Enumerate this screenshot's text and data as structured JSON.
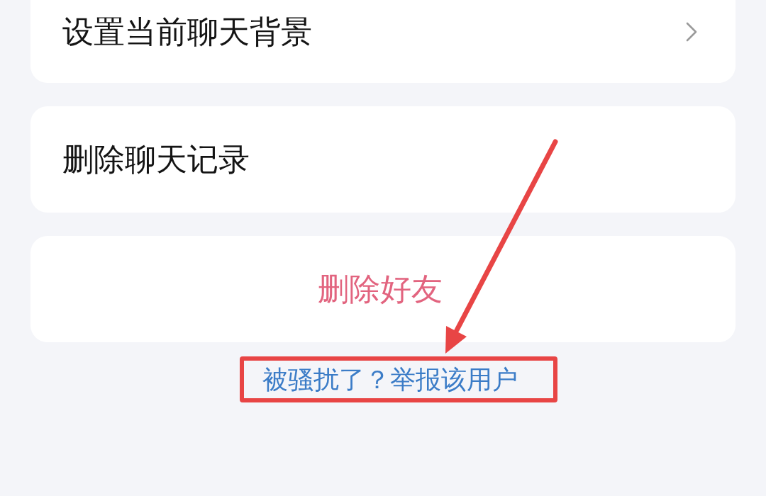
{
  "settings": [
    {
      "label": "设置当前聊天背景",
      "kind": "nav"
    },
    {
      "label": "删除聊天记录",
      "kind": "plain"
    },
    {
      "label": "删除好友",
      "kind": "danger"
    }
  ],
  "report_link": {
    "text": "被骚扰了？举报该用户",
    "framed": true,
    "arrow": true
  }
}
